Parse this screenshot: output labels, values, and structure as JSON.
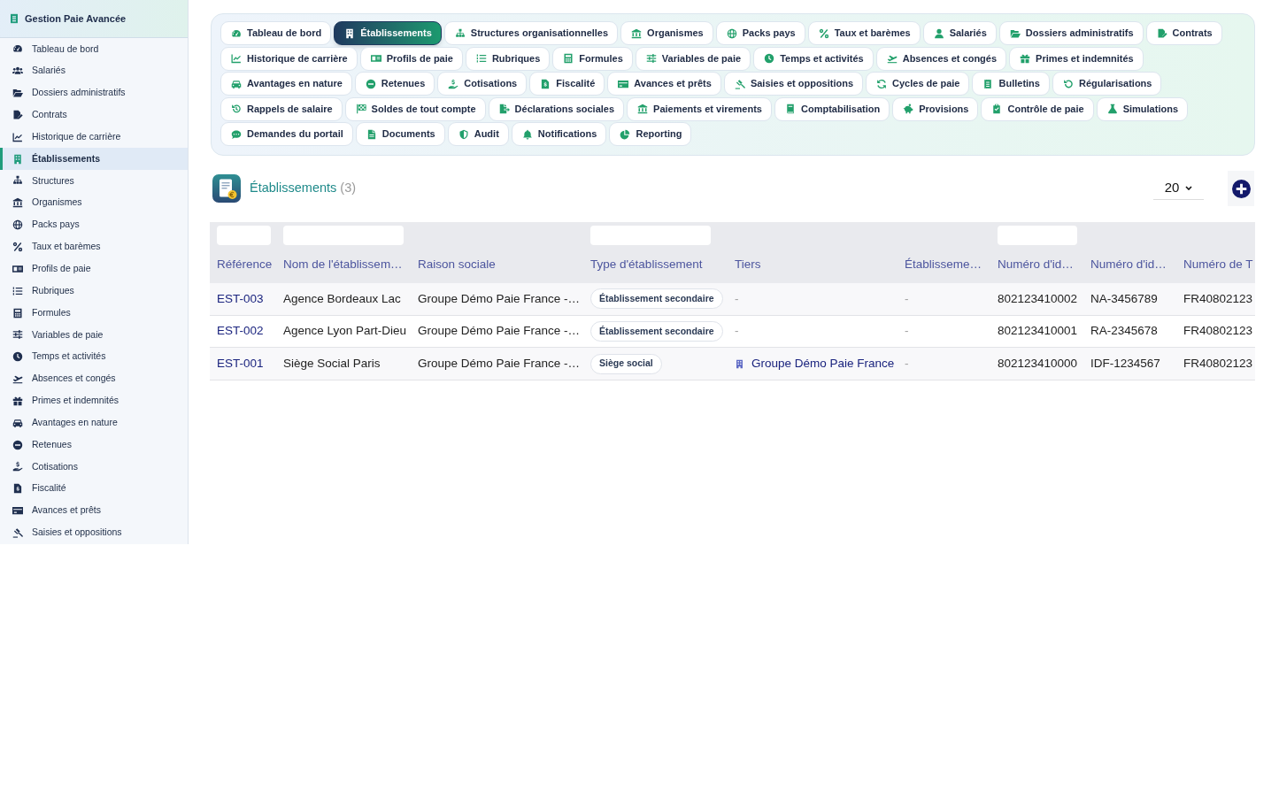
{
  "sidebar": {
    "title": "Gestion Paie Avancée",
    "items": [
      {
        "label": "Tableau de bord",
        "selected": false
      },
      {
        "label": "Salariés",
        "selected": false
      },
      {
        "label": "Dossiers administratifs",
        "selected": false
      },
      {
        "label": "Contrats",
        "selected": false
      },
      {
        "label": "Historique de carrière",
        "selected": false
      },
      {
        "label": "Établissements",
        "selected": true
      },
      {
        "label": "Structures",
        "selected": false
      },
      {
        "label": "Organismes",
        "selected": false
      },
      {
        "label": "Packs pays",
        "selected": false
      },
      {
        "label": "Taux et barèmes",
        "selected": false
      },
      {
        "label": "Profils de paie",
        "selected": false
      },
      {
        "label": "Rubriques",
        "selected": false
      },
      {
        "label": "Formules",
        "selected": false
      },
      {
        "label": "Variables de paie",
        "selected": false
      },
      {
        "label": "Temps et activités",
        "selected": false
      },
      {
        "label": "Absences et congés",
        "selected": false
      },
      {
        "label": "Primes et indemnités",
        "selected": false
      },
      {
        "label": "Avantages en nature",
        "selected": false
      },
      {
        "label": "Retenues",
        "selected": false
      },
      {
        "label": "Cotisations",
        "selected": false
      },
      {
        "label": "Fiscalité",
        "selected": false
      },
      {
        "label": "Avances et prêts",
        "selected": false
      },
      {
        "label": "Saisies et oppositions",
        "selected": false
      }
    ]
  },
  "tabs": [
    {
      "label": "Tableau de bord",
      "selected": false
    },
    {
      "label": "Établissements",
      "selected": true
    },
    {
      "label": "Structures organisationnelles",
      "selected": false
    },
    {
      "label": "Organismes",
      "selected": false
    },
    {
      "label": "Packs pays",
      "selected": false
    },
    {
      "label": "Taux et barèmes",
      "selected": false
    },
    {
      "label": "Salariés",
      "selected": false
    },
    {
      "label": "Dossiers administratifs",
      "selected": false
    },
    {
      "label": "Contrats",
      "selected": false
    },
    {
      "label": "Historique de carrière",
      "selected": false
    },
    {
      "label": "Profils de paie",
      "selected": false
    },
    {
      "label": "Rubriques",
      "selected": false
    },
    {
      "label": "Formules",
      "selected": false
    },
    {
      "label": "Variables de paie",
      "selected": false
    },
    {
      "label": "Temps et activités",
      "selected": false
    },
    {
      "label": "Absences et congés",
      "selected": false
    },
    {
      "label": "Primes et indemnités",
      "selected": false
    },
    {
      "label": "Avantages en nature",
      "selected": false
    },
    {
      "label": "Retenues",
      "selected": false
    },
    {
      "label": "Cotisations",
      "selected": false
    },
    {
      "label": "Fiscalité",
      "selected": false
    },
    {
      "label": "Avances et prêts",
      "selected": false
    },
    {
      "label": "Saisies et oppositions",
      "selected": false
    },
    {
      "label": "Cycles de paie",
      "selected": false
    },
    {
      "label": "Bulletins",
      "selected": false
    },
    {
      "label": "Régularisations",
      "selected": false
    },
    {
      "label": "Rappels de salaire",
      "selected": false
    },
    {
      "label": "Soldes de tout compte",
      "selected": false
    },
    {
      "label": "Déclarations sociales",
      "selected": false
    },
    {
      "label": "Paiements et virements",
      "selected": false
    },
    {
      "label": "Comptabilisation",
      "selected": false
    },
    {
      "label": "Provisions",
      "selected": false
    },
    {
      "label": "Contrôle de paie",
      "selected": false
    },
    {
      "label": "Simulations",
      "selected": false
    },
    {
      "label": "Demandes du portail",
      "selected": false
    },
    {
      "label": "Documents",
      "selected": false
    },
    {
      "label": "Audit",
      "selected": false
    },
    {
      "label": "Notifications",
      "selected": false
    },
    {
      "label": "Reporting",
      "selected": false
    }
  ],
  "page_header": {
    "title": "Établissements",
    "count": "(3)",
    "page_size": "20"
  },
  "table": {
    "columns": [
      {
        "label": "Référence",
        "filter": true
      },
      {
        "label": "Nom de l'établissem…",
        "filter": true
      },
      {
        "label": "Raison sociale",
        "filter": false
      },
      {
        "label": "Type d'établissement",
        "filter": true
      },
      {
        "label": "Tiers",
        "filter": false
      },
      {
        "label": "Établisseme…",
        "filter": false
      },
      {
        "label": "Numéro d'id…",
        "filter": true
      },
      {
        "label": "Numéro d'id…",
        "filter": false
      },
      {
        "label": "Numéro de T",
        "filter": false
      }
    ],
    "rows": [
      {
        "cells": [
          {
            "kind": "reference",
            "text": "EST-003"
          },
          {
            "kind": "text",
            "text": "Agence Bordeaux Lac"
          },
          {
            "kind": "text",
            "text": "Groupe Démo Paie France -…"
          },
          {
            "kind": "badge",
            "text": "Établissement secondaire"
          },
          {
            "kind": "empty",
            "text": "-"
          },
          {
            "kind": "empty",
            "text": "-"
          },
          {
            "kind": "text",
            "text": "802123410002"
          },
          {
            "kind": "text",
            "text": "NA-3456789"
          },
          {
            "kind": "text",
            "text": "FR40802123"
          }
        ]
      },
      {
        "cells": [
          {
            "kind": "reference",
            "text": "EST-002"
          },
          {
            "kind": "text",
            "text": "Agence Lyon Part-Dieu"
          },
          {
            "kind": "text",
            "text": "Groupe Démo Paie France -…"
          },
          {
            "kind": "badge",
            "text": "Établissement secondaire"
          },
          {
            "kind": "empty",
            "text": "-"
          },
          {
            "kind": "empty",
            "text": "-"
          },
          {
            "kind": "text",
            "text": "802123410001"
          },
          {
            "kind": "text",
            "text": "RA-2345678"
          },
          {
            "kind": "text",
            "text": "FR40802123"
          }
        ]
      },
      {
        "cells": [
          {
            "kind": "reference",
            "text": "EST-001"
          },
          {
            "kind": "text",
            "text": "Siège Social Paris"
          },
          {
            "kind": "text",
            "text": "Groupe Démo Paie France -…"
          },
          {
            "kind": "badge",
            "text": "Siège social"
          },
          {
            "kind": "entity",
            "text": "Groupe Démo Paie France"
          },
          {
            "kind": "empty",
            "text": "-"
          },
          {
            "kind": "text",
            "text": "802123410000"
          },
          {
            "kind": "text",
            "text": "IDF-1234567"
          },
          {
            "kind": "text",
            "text": "FR40802123"
          }
        ]
      }
    ]
  }
}
